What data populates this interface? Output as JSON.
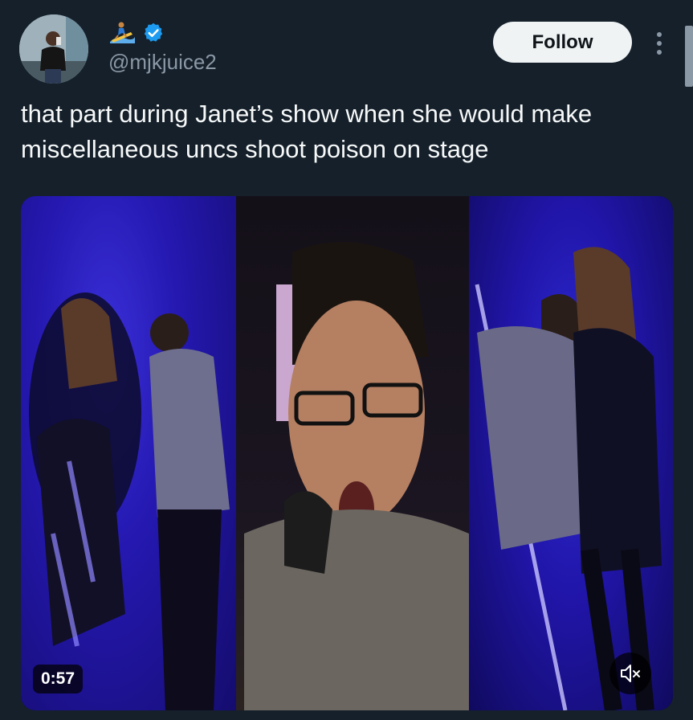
{
  "author": {
    "display_name_emoji": "surfer-emoji",
    "verified": true,
    "handle": "@mjkjuice2"
  },
  "actions": {
    "follow_label": "Follow",
    "more_icon": "more-vertical-icon"
  },
  "tweet": {
    "text": "that part during Janet’s show when she would make miscellaneous uncs shoot poison on stage"
  },
  "media": {
    "type": "video",
    "duration": "0:57",
    "muted": true,
    "mute_icon": "speaker-muted-icon"
  },
  "colors": {
    "background": "#15202b",
    "verified_blue": "#1d9bf0",
    "secondary_text": "#8b98a5",
    "follow_button_bg": "#eff3f4"
  }
}
